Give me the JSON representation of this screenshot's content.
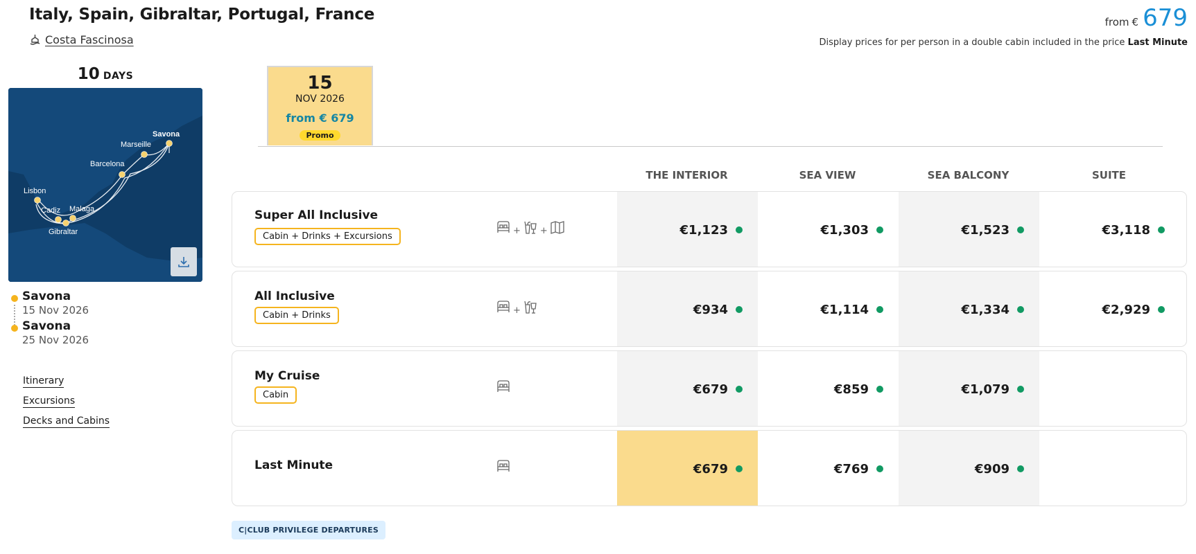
{
  "header": {
    "title": "Italy, Spain, Gibraltar, Portugal, France",
    "ship_name": "Costa Fascinosa",
    "from_label": "from",
    "from_currency": "€",
    "from_amount": "679",
    "note_text": "Display prices for per person in a double cabin included in the price",
    "note_bold": "Last Minute"
  },
  "trip": {
    "days_number": "10",
    "days_label": "DAYS"
  },
  "map": {
    "labels": {
      "savona": "Savona",
      "marseille": "Marseille",
      "barcelona": "Barcelona",
      "lisbon": "Lisbon",
      "cadiz": "Cadiz",
      "malaga": "Malaga",
      "gibraltar": "Gibraltar"
    },
    "download_icon": "download-icon",
    "sea_color": "#0f3c66",
    "port_color": "#f5d270"
  },
  "ports": [
    {
      "name": "Savona",
      "date": "15 Nov 2026"
    },
    {
      "name": "Savona",
      "date": "25 Nov 2026"
    }
  ],
  "links": {
    "itinerary": "Itinerary",
    "excursions": "Excursions",
    "decks": "Decks and Cabins"
  },
  "departure": {
    "day": "15",
    "month": "NOV 2026",
    "price": "from € 679",
    "badge": "Promo"
  },
  "columns": [
    "THE INTERIOR",
    "SEA VIEW",
    "SEA BALCONY",
    "SUITE"
  ],
  "packages": [
    {
      "name": "Super All Inclusive",
      "tag": "Cabin + Drinks + Excursions",
      "icons": [
        "bed-icon",
        "drinks-icon",
        "map-icon"
      ],
      "prices": [
        "€1,123",
        "€1,303",
        "€1,523",
        "€3,118"
      ]
    },
    {
      "name": "All Inclusive",
      "tag": "Cabin + Drinks",
      "icons": [
        "bed-icon",
        "drinks-icon"
      ],
      "prices": [
        "€934",
        "€1,114",
        "€1,334",
        "€2,929"
      ]
    },
    {
      "name": "My Cruise",
      "tag": "Cabin",
      "icons": [
        "bed-icon"
      ],
      "prices": [
        "€679",
        "€859",
        "€1,079",
        ""
      ]
    },
    {
      "name": "Last Minute",
      "tag": "",
      "icons": [
        "bed-icon"
      ],
      "prices": [
        "€679",
        "€769",
        "€909",
        ""
      ]
    }
  ],
  "availability_color": "#119a63",
  "highlight_color": "#fadb8d",
  "club": {
    "label": "C|CLUB PRIVILEGE DEPARTURES"
  }
}
